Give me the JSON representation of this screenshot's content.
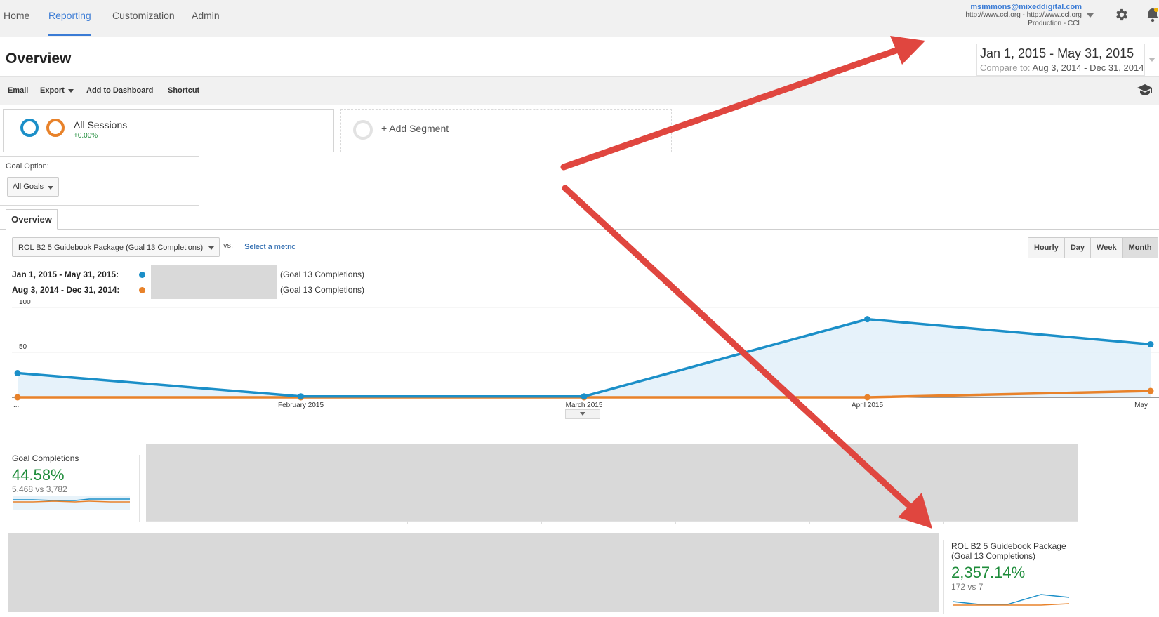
{
  "nav": {
    "tabs": [
      {
        "label": "Home"
      },
      {
        "label": "Reporting"
      },
      {
        "label": "Customization"
      },
      {
        "label": "Admin"
      }
    ],
    "active_tab": "Reporting",
    "account": {
      "email": "msimmons@mixeddigital.com",
      "property": "http://www.ccl.org - http://www.ccl.org",
      "view": "Production - CCL"
    },
    "icons": [
      "gear-icon",
      "bell-icon",
      "chevron-down-icon"
    ]
  },
  "header": {
    "title": "Overview",
    "date_range": "Jan 1, 2015 - May 31, 2015",
    "compare_label": "Compare to:",
    "compare_range": "Aug 3, 2014 - Dec 31, 2014"
  },
  "toolbar": {
    "email": "Email",
    "export": "Export",
    "add_to_dashboard": "Add to Dashboard",
    "shortcut": "Shortcut"
  },
  "segments": {
    "active": {
      "name": "All Sessions",
      "change": "+0.00%"
    },
    "add_label": "+ Add Segment",
    "colors": {
      "current": "#1b8fc8",
      "previous": "#e8822a"
    }
  },
  "goal_option": {
    "label": "Goal Option:",
    "value": "All Goals"
  },
  "tabs": [
    {
      "label": "Overview"
    }
  ],
  "metric_row": {
    "metric": "ROL B2 5 Guidebook Package (Goal 13 Completions)",
    "vs": "vs.",
    "select_metric": "Select a metric",
    "granularity": [
      "Hourly",
      "Day",
      "Week",
      "Month"
    ],
    "active_granularity": "Month"
  },
  "legend": [
    {
      "range": "Jan 1, 2015 - May 31, 2015:",
      "suffix": "(Goal 13 Completions)",
      "color": "#1b8fc8"
    },
    {
      "range": "Aug 3, 2014 - Dec 31, 2014:",
      "suffix": "(Goal 13 Completions)",
      "color": "#e8822a"
    }
  ],
  "chart_data": {
    "type": "area",
    "categories": [
      "...",
      "February 2015",
      "March 2015",
      "April 2015",
      "May"
    ],
    "y_ticks": [
      "100",
      "50"
    ],
    "ylim": [
      0,
      100
    ],
    "grid": true,
    "series": [
      {
        "values": [
          27,
          1,
          1,
          87,
          59
        ],
        "color": "#1b8fc8"
      },
      {
        "values": [
          0,
          0,
          0,
          0,
          7
        ],
        "color": "#e8822a"
      }
    ]
  },
  "scorecards": {
    "goal_completions": {
      "title": "Goal Completions",
      "change": "44.58%",
      "compare": "5,468 vs 3,782"
    },
    "rol_package": {
      "title_line1": "ROL B2 5 Guidebook Package",
      "title_line2": "(Goal 13 Completions)",
      "change": "2,357.14%",
      "compare": "172 vs 7"
    }
  }
}
